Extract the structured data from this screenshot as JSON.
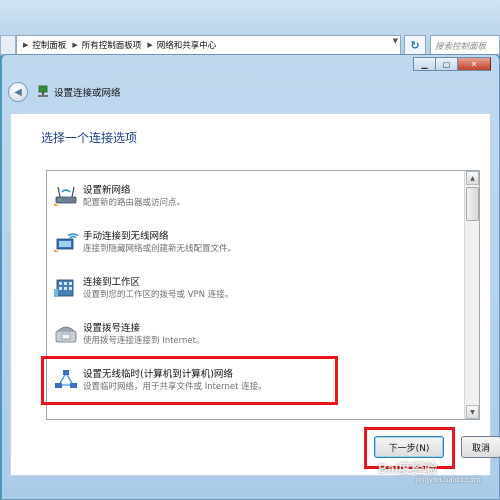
{
  "explorer": {
    "breadcrumbs": [
      "控制面板",
      "所有控制面板项",
      "网络和共享中心"
    ],
    "search_placeholder": "搜索控制面板"
  },
  "dialog": {
    "title": "设置连接或网络",
    "heading": "选择一个连接选项",
    "options": [
      {
        "title": "设置新网络",
        "desc": "配置新的路由器或访问点。",
        "icon": "router-icon"
      },
      {
        "title": "手动连接到无线网络",
        "desc": "连接到隐藏网络或创建新无线配置文件。",
        "icon": "wireless-icon"
      },
      {
        "title": "连接到工作区",
        "desc": "设置到您的工作区的拨号或 VPN 连接。",
        "icon": "workplace-icon"
      },
      {
        "title": "设置拨号连接",
        "desc": "使用拨号连接连接到 Internet。",
        "icon": "dialup-phone-icon"
      },
      {
        "title": "设置无线临时(计算机到计算机)网络",
        "desc": "设置临时网络，用于共享文件或 Internet 连接。",
        "icon": "adhoc-network-icon"
      }
    ],
    "buttons": {
      "next": "下一步(N)",
      "cancel": "取消"
    }
  },
  "watermark": {
    "brand": "Bai度经验",
    "sub": "jingyan.baidu.com"
  },
  "colors": {
    "highlight": "#e8141b",
    "heading": "#1e3f8f"
  }
}
